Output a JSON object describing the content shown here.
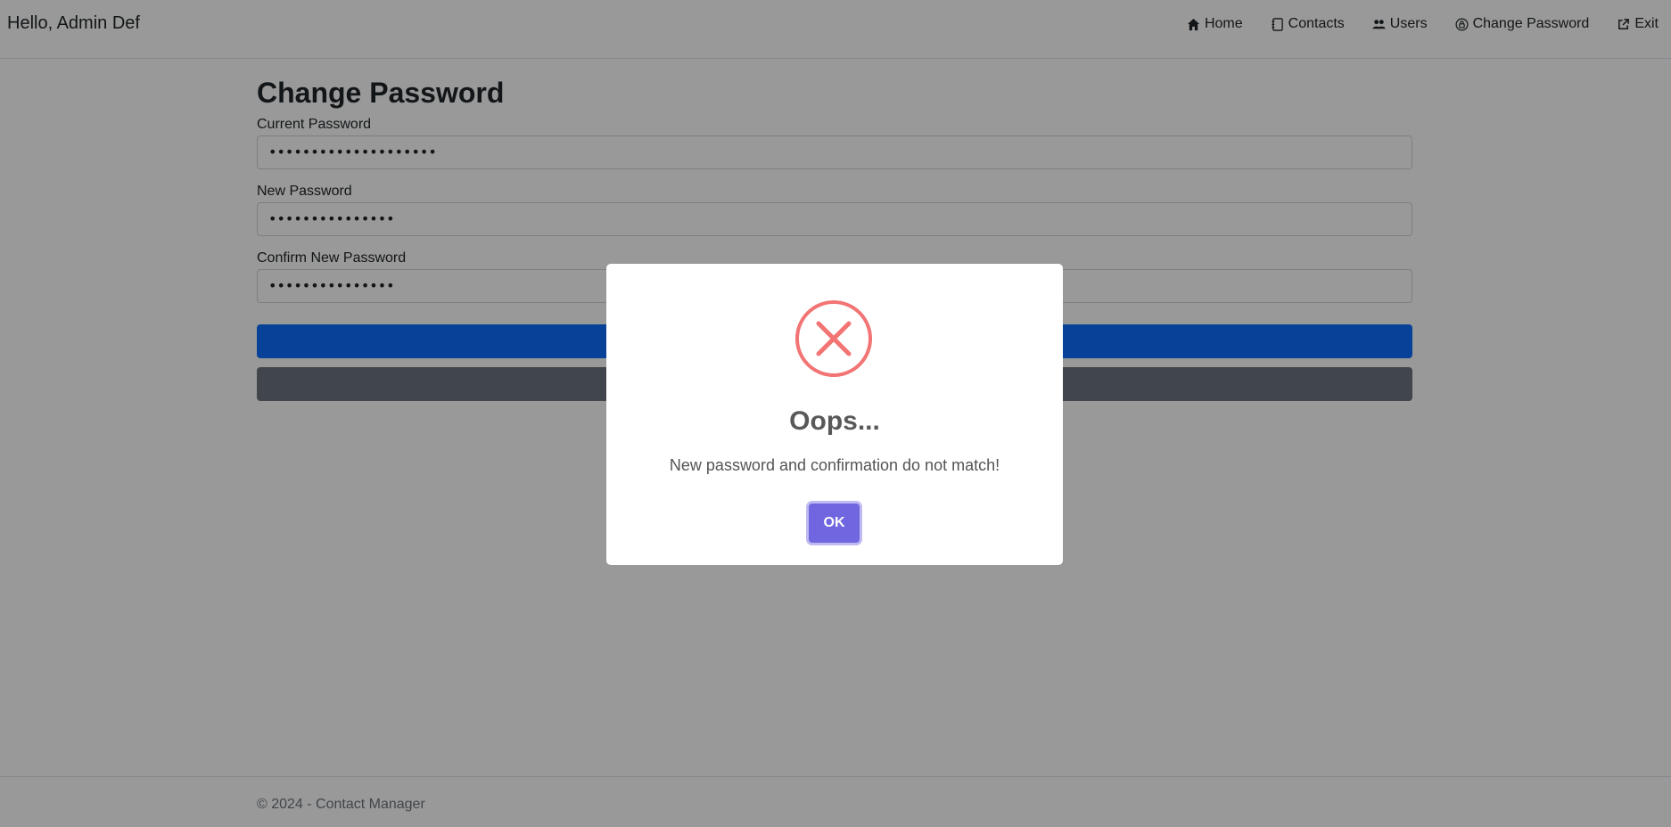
{
  "navbar": {
    "greeting": "Hello, Admin Def",
    "items": [
      {
        "label": "Home",
        "icon": "home-icon"
      },
      {
        "label": "Contacts",
        "icon": "address-book-icon"
      },
      {
        "label": "Users",
        "icon": "users-icon"
      },
      {
        "label": "Change Password",
        "icon": "lock-icon"
      },
      {
        "label": "Exit",
        "icon": "external-link-icon"
      }
    ]
  },
  "main": {
    "title": "Change Password",
    "fields": [
      {
        "label": "Current Password",
        "value": "••••••••••••••••••••"
      },
      {
        "label": "New Password",
        "value": "•••••••••••••••"
      },
      {
        "label": "Confirm New Password",
        "value": "•••••••••••••••"
      }
    ]
  },
  "footer": {
    "text": "© 2024 - Contact Manager"
  },
  "modal": {
    "icon": "error-x-icon",
    "title": "Oops...",
    "message": "New password and confirmation do not match!",
    "ok_label": "OK"
  },
  "colors": {
    "primary": "#0d6efd",
    "secondary": "#6c757d",
    "error": "#f27474",
    "confirm_button": "#7066e0"
  }
}
